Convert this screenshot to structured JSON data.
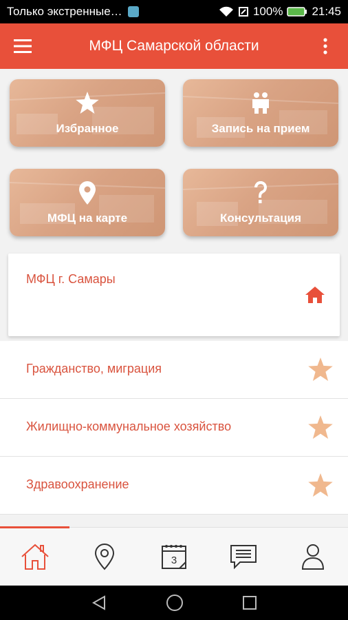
{
  "status_bar": {
    "notification_text": "Только экстренные…",
    "battery": "100%",
    "time": "21:45",
    "icons": [
      "wifi-icon",
      "signal-icon",
      "battery-icon"
    ]
  },
  "app_bar": {
    "title": "МФЦ Самарской области",
    "menu_icon": "hamburger-icon",
    "more_icon": "more-vertical-icon"
  },
  "tiles": [
    {
      "label": "Избранное",
      "icon": "star-icon"
    },
    {
      "label": "Запись на прием",
      "icon": "people-icon"
    },
    {
      "label": "МФЦ на карте",
      "icon": "location-pin-icon"
    },
    {
      "label": "Консультация",
      "icon": "question-icon"
    }
  ],
  "selected_office": {
    "label": "МФЦ г. Самары",
    "icon": "home-icon"
  },
  "categories": [
    {
      "label": "Гражданство, миграция",
      "icon": "star-icon"
    },
    {
      "label": "Жилищно-коммунальное хозяйство",
      "icon": "star-icon"
    },
    {
      "label": "Здравоохранение",
      "icon": "star-icon"
    }
  ],
  "bottom_nav": {
    "items": [
      "home-icon",
      "map-pin-icon",
      "calendar-icon",
      "chat-icon",
      "profile-icon"
    ],
    "calendar_day": "3",
    "active_index": 0
  },
  "colors": {
    "accent": "#e8503a",
    "text_accent": "#d9533e",
    "star": "#f0b88e",
    "tile": "#d9a384"
  }
}
